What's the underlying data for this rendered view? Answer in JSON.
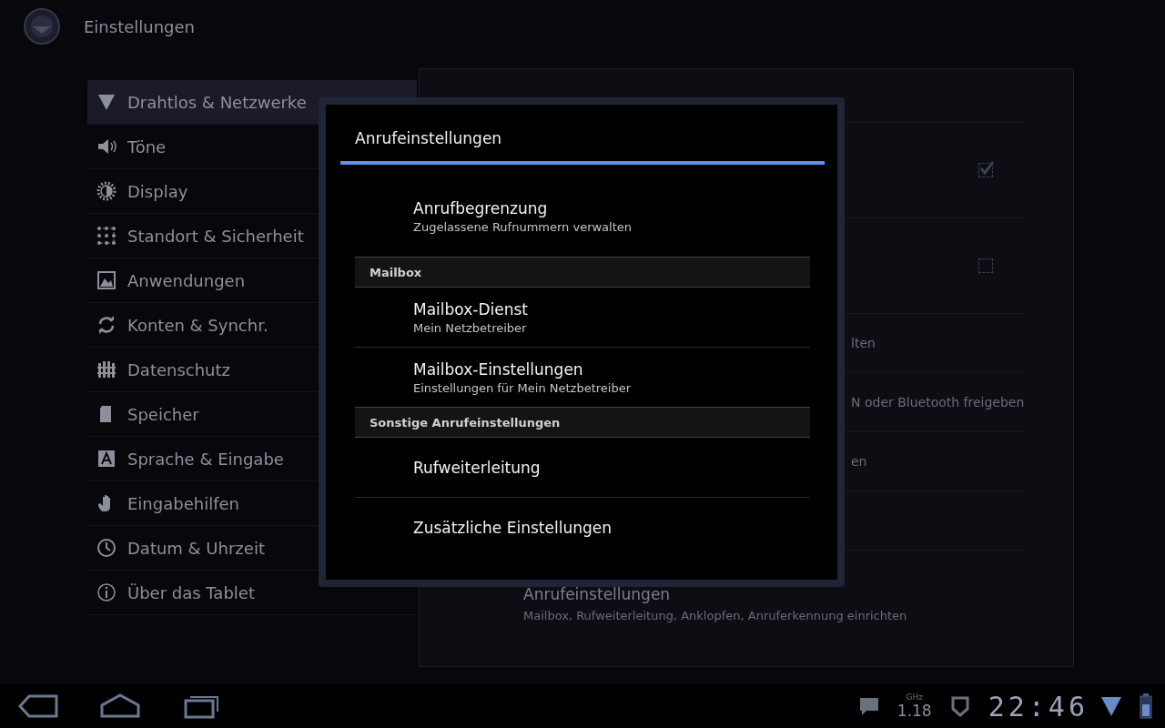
{
  "app_bar": {
    "title": "Einstellungen"
  },
  "sidebar": {
    "items": [
      {
        "label": "Drahtlos & Netzwerke",
        "selected": true
      },
      {
        "label": "Töne",
        "selected": false
      },
      {
        "label": "Display",
        "selected": false
      },
      {
        "label": "Standort & Sicherheit",
        "selected": false
      },
      {
        "label": "Anwendungen",
        "selected": false
      },
      {
        "label": "Konten & Synchr.",
        "selected": false
      },
      {
        "label": "Datenschutz",
        "selected": false
      },
      {
        "label": "Speicher",
        "selected": false
      },
      {
        "label": "Sprache & Eingabe",
        "selected": false
      },
      {
        "label": "Eingabehilfen",
        "selected": false
      },
      {
        "label": "Datum & Uhrzeit",
        "selected": false
      },
      {
        "label": "Über das Tablet",
        "selected": false
      }
    ]
  },
  "panel": {
    "rows": [
      {
        "kind": "checkbox",
        "checked": true
      },
      {
        "kind": "checkbox",
        "checked": false
      },
      {
        "kind": "fragment",
        "text": "lten"
      },
      {
        "kind": "fragment",
        "text": "N oder Bluetooth freigeben"
      },
      {
        "kind": "fragment",
        "text": "en"
      },
      {
        "kind": "blank"
      },
      {
        "kind": "entry",
        "title": "Anrufeinstellungen",
        "summary": "Mailbox, Rufweiterleitung, Anklopfen, Anruferkennung einrichten"
      }
    ]
  },
  "dialog": {
    "title": "Anrufeinstellungen",
    "items": [
      {
        "kind": "entry",
        "title": "Anrufbegrenzung",
        "summary": "Zugelassene Rufnummern verwalten"
      },
      {
        "kind": "header",
        "title": "Mailbox"
      },
      {
        "kind": "entry",
        "title": "Mailbox-Dienst",
        "summary": "Mein Netzbetreiber"
      },
      {
        "kind": "entry",
        "title": "Mailbox-Einstellungen",
        "summary": "Einstellungen für Mein Netzbetreiber"
      },
      {
        "kind": "header",
        "title": "Sonstige Anrufeinstellungen"
      },
      {
        "kind": "entry",
        "title": "Rufweiterleitung"
      },
      {
        "kind": "entry",
        "title": "Zusätzliche Einstellungen"
      }
    ]
  },
  "status_bar": {
    "cpu_unit": "GHz",
    "cpu_value": "1.18",
    "time": "22:46"
  }
}
